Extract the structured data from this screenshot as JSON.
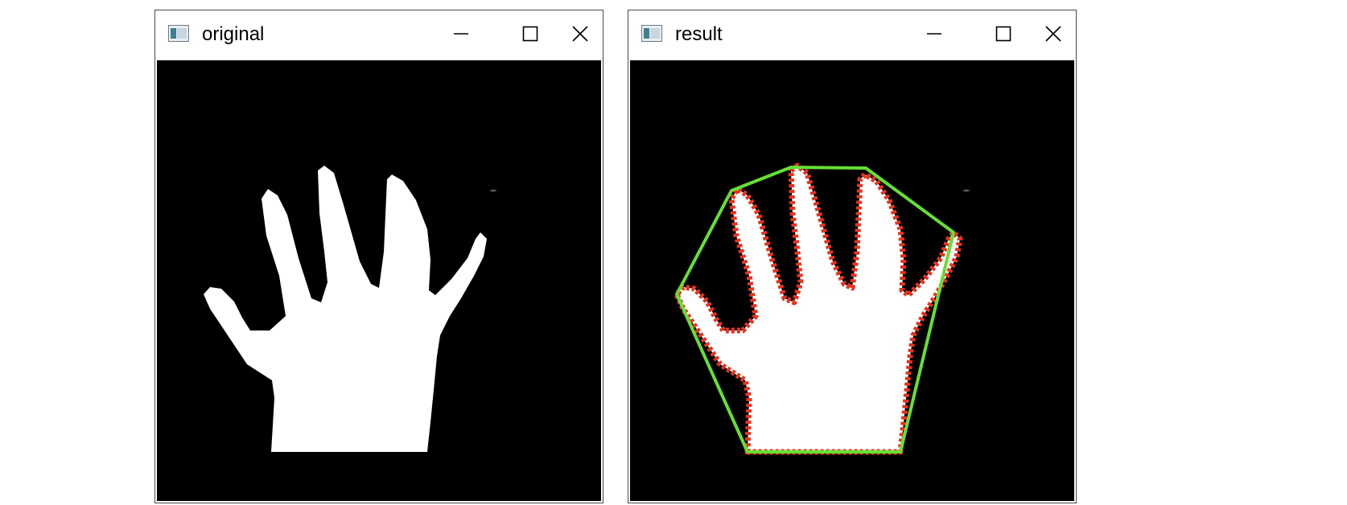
{
  "windows": [
    {
      "title": "original",
      "icon": "app-window-icon",
      "controls": [
        "minimize-icon",
        "maximize-icon",
        "close-icon"
      ]
    },
    {
      "title": "result",
      "icon": "app-window-icon",
      "controls": [
        "minimize-icon",
        "maximize-icon",
        "close-icon"
      ]
    }
  ],
  "colors": {
    "background": "#000000",
    "hand": "#ffffff",
    "contour": "#e8321e",
    "hull": "#66e033"
  }
}
